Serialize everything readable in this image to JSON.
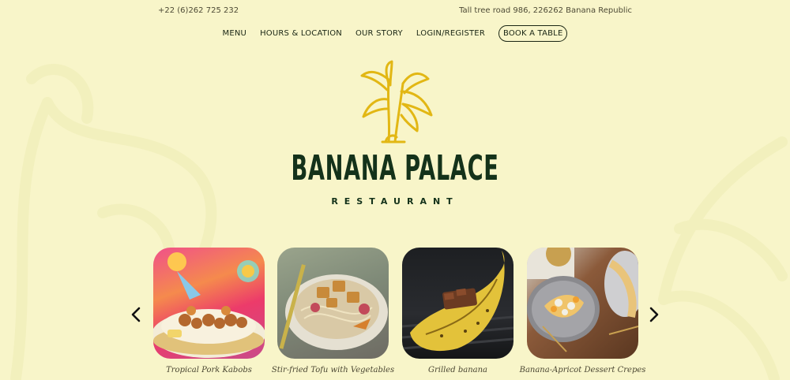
{
  "contact": {
    "phone": "+22 (6)262 725 232",
    "address": "Tall tree road 986, 226262 Banana Republic"
  },
  "nav": {
    "menu": "MENU",
    "hours": "HOURS & LOCATION",
    "story": "OUR STORY",
    "login": "LOGIN/REGISTER",
    "book": "BOOK A TABLE"
  },
  "brand": {
    "name": "BANANA PALACE",
    "tagline": "RESTAURANT"
  },
  "colors": {
    "background": "#f8f5c9",
    "brand_green": "#14321a",
    "logo_yellow": "#e2b714"
  },
  "carousel": {
    "prev_icon": "chevron-left-icon",
    "next_icon": "chevron-right-icon",
    "items": [
      {
        "caption": "Tropical Pork Kabobs"
      },
      {
        "caption": "Stir-fried Tofu with Vegetables"
      },
      {
        "caption": "Grilled banana"
      },
      {
        "caption": "Banana-Apricot Dessert Crepes"
      }
    ]
  }
}
